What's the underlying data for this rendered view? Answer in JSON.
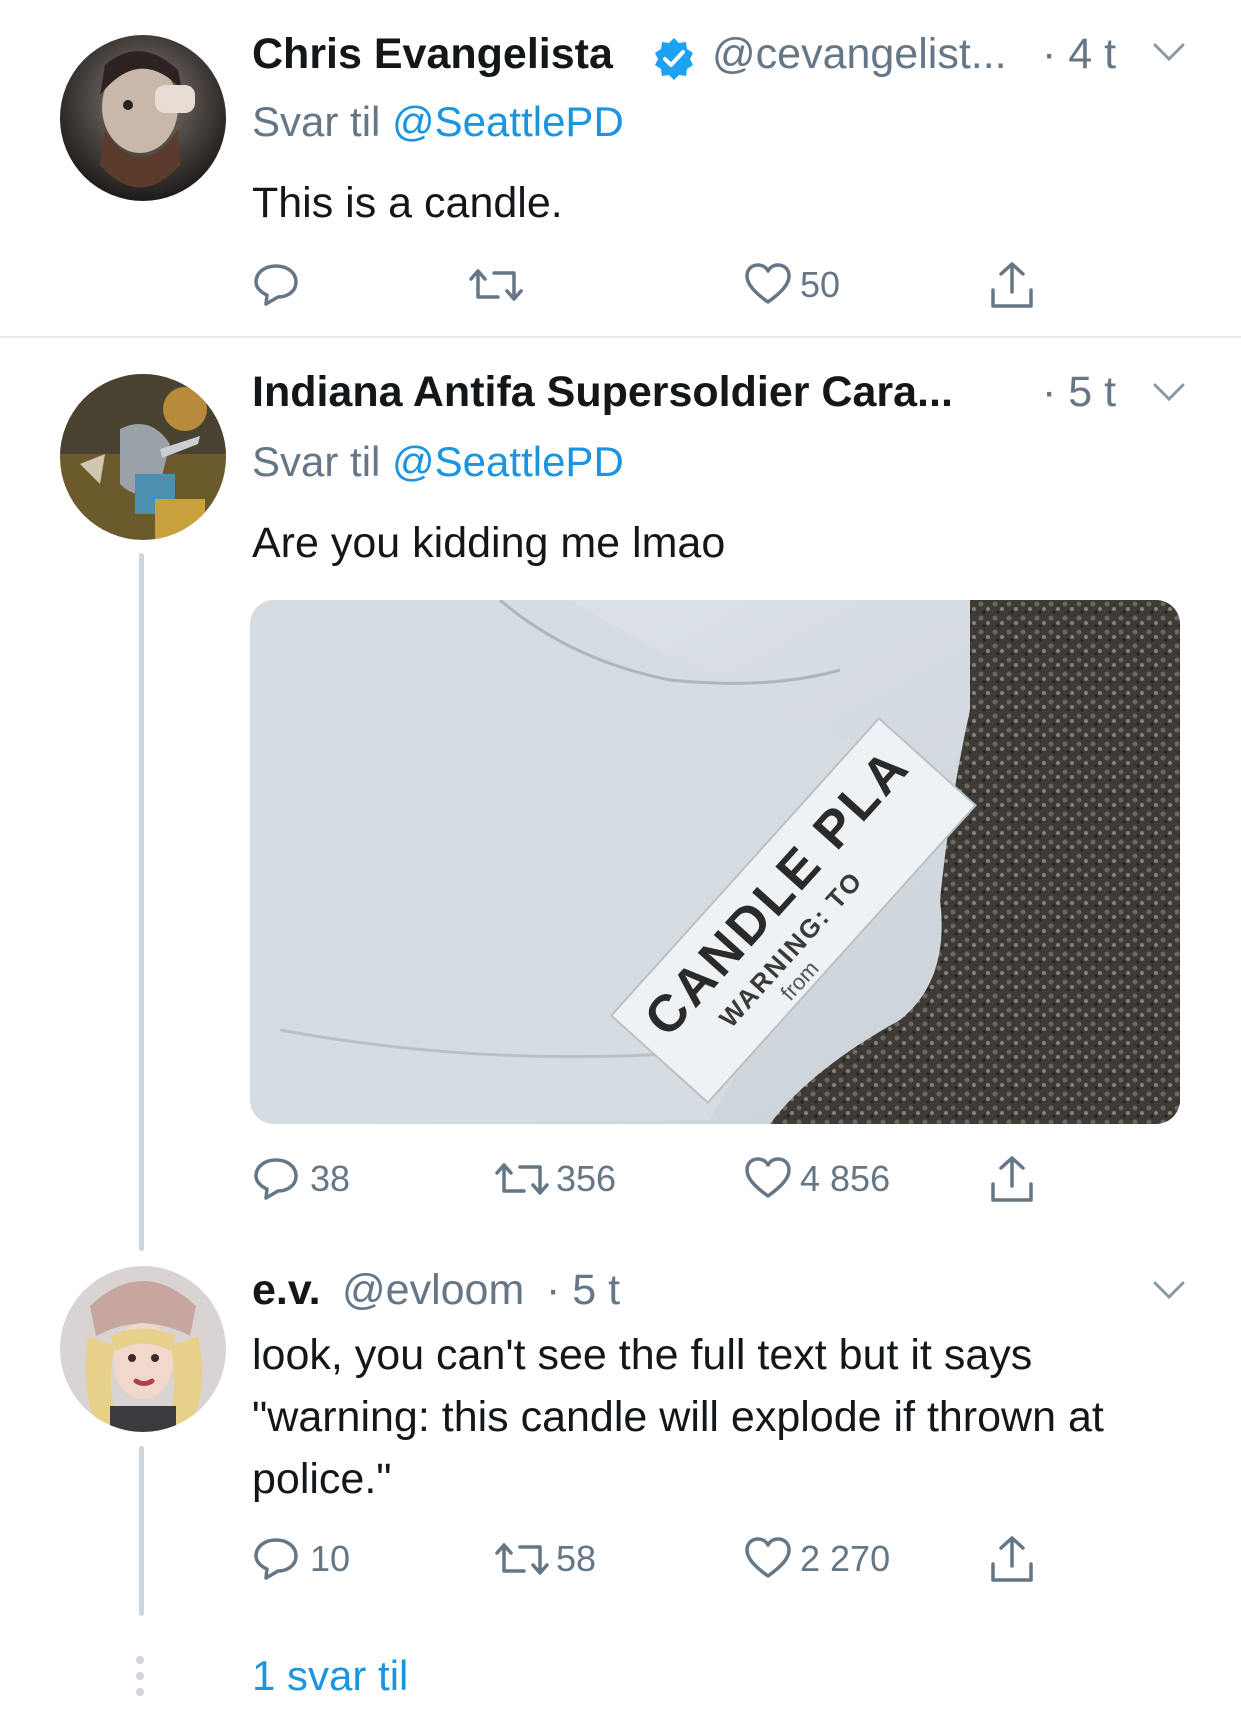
{
  "colors": {
    "accent": "#1b95e0",
    "muted": "#657786",
    "text": "#14171a",
    "divider": "#e6ecf0",
    "thread": "#ccd6dd"
  },
  "tweets": [
    {
      "display_name": "Chris Evangelista",
      "verified": true,
      "handle": "@cevangelist...",
      "time": "· 4 t",
      "reply_prefix": "Svar til",
      "reply_handle": "@SeattlePD",
      "text": "This is a candle.",
      "actions": {
        "reply": "",
        "retweet": "",
        "like": "50"
      }
    },
    {
      "display_name": "Indiana Antifa Supersoldier Cara...",
      "handle": "",
      "time": "· 5 t",
      "reply_prefix": "Svar til",
      "reply_handle": "@SeattlePD",
      "text": "Are you kidding me lmao",
      "media": {
        "label_line1": "CANDLE PLA",
        "label_line2": "WARNING: TO",
        "label_line3": "from"
      },
      "actions": {
        "reply": "38",
        "retweet": "356",
        "like": "4 856"
      }
    },
    {
      "display_name": "e.v.",
      "handle": "@evloom",
      "time": "· 5 t",
      "text": "look, you can't see the full text but it says \"warning: this candle will explode if thrown at police.\"",
      "actions": {
        "reply": "10",
        "retweet": "58",
        "like": "2 270"
      }
    }
  ],
  "more_replies": "1 svar til",
  "icons": [
    "reply-icon",
    "retweet-icon",
    "like-icon",
    "share-icon",
    "chevron-down-icon",
    "verified-badge-icon",
    "more-dots-icon"
  ]
}
